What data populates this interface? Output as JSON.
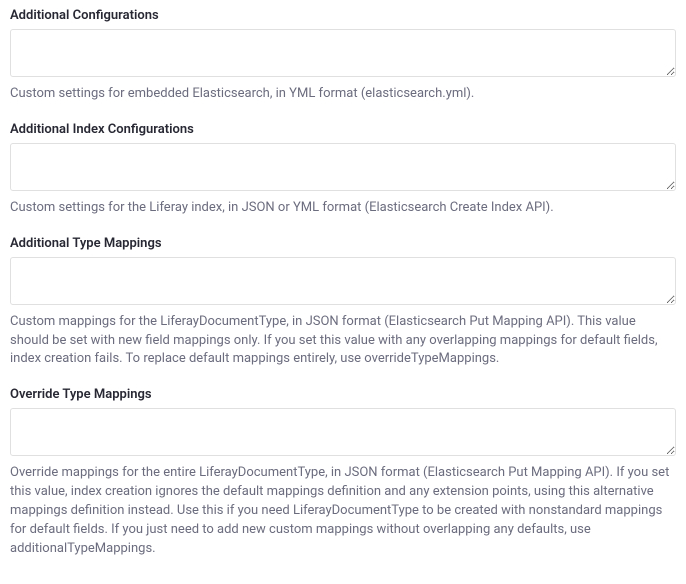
{
  "fields": [
    {
      "label": "Additional Configurations",
      "value": "",
      "help": "Custom settings for embedded Elasticsearch, in YML format (elasticsearch.yml)."
    },
    {
      "label": "Additional Index Configurations",
      "value": "",
      "help": "Custom settings for the Liferay index, in JSON or YML format (Elasticsearch Create Index API)."
    },
    {
      "label": "Additional Type Mappings",
      "value": "",
      "help": "Custom mappings for the LiferayDocumentType, in JSON format (Elasticsearch Put Mapping API). This value should be set with new field mappings only. If you set this value with any overlapping mappings for default fields, index creation fails. To replace default mappings entirely, use overrideTypeMappings."
    },
    {
      "label": "Override Type Mappings",
      "value": "",
      "help": "Override mappings for the entire LiferayDocumentType, in JSON format (Elasticsearch Put Mapping API). If you set this value, index creation ignores the default mappings definition and any extension points, using this alternative mappings definition instead. Use this if you need LiferayDocumentType to be created with nonstandard mappings for default fields. If you just need to add new custom mappings without overlapping any defaults, use additionalTypeMappings."
    }
  ]
}
